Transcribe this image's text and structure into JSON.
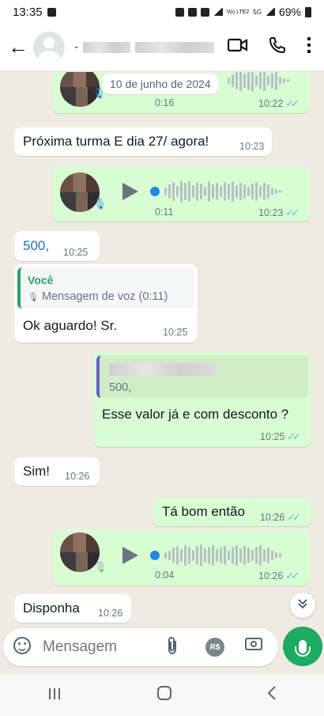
{
  "status_bar": {
    "time": "13:35",
    "network": "Vo) LTE2",
    "signal": "5G",
    "battery": "69%"
  },
  "header": {
    "contact_name": "",
    "video_icon": "video-call-icon",
    "call_icon": "phone-icon",
    "menu_icon": "more-vert-icon"
  },
  "date_chip": "10 de junho de 2024",
  "messages": {
    "voice1": {
      "duration": "0:16",
      "time": "10:22"
    },
    "m1": {
      "text": "Próxima turma E dia 27/ agora!",
      "time": "10:23"
    },
    "voice2": {
      "duration": "0:11",
      "time": "10:23"
    },
    "m2": {
      "text": "500,",
      "time": "10:25"
    },
    "m3": {
      "quote_author": "Você",
      "quote_text": "Mensagem de voz (0:11)",
      "text": "Ok aguardo! Sr.",
      "time": "10:25"
    },
    "m4": {
      "quote_text": "500,",
      "text": "Esse valor já e com desconto ?",
      "time": "10:25"
    },
    "m5": {
      "text": "Sim!",
      "time": "10:26"
    },
    "m6": {
      "text": "Tá bom então",
      "time": "10:26"
    },
    "voice3": {
      "duration": "0:04",
      "time": "10:26"
    },
    "m7": {
      "text": "Disponha",
      "time": "10:26"
    }
  },
  "composer": {
    "placeholder": "Mensagem"
  },
  "colors": {
    "outgoing": "#d9fdd3",
    "incoming": "#ffffff",
    "accent_green": "#1daa61",
    "tick_blue": "#53bdeb"
  }
}
